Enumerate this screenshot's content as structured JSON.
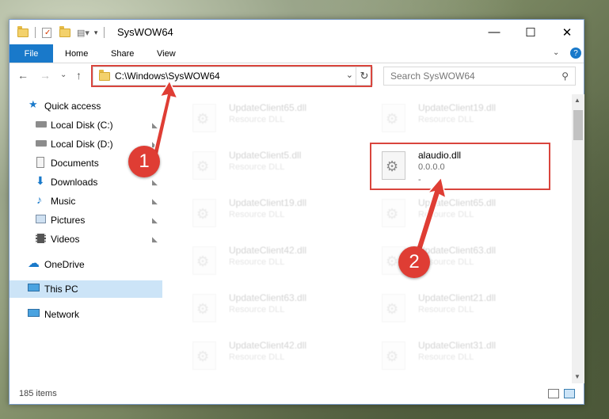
{
  "window": {
    "title": "SysWOW64",
    "buttons": {
      "minimize": "—",
      "maximize": "☐",
      "close": "✕"
    }
  },
  "ribbon": {
    "tabs": [
      "File",
      "Home",
      "Share",
      "View"
    ],
    "help": "?"
  },
  "navigation": {
    "back": "←",
    "forward": "→",
    "dropdown": "⌄",
    "up": "↑",
    "address": "C:\\Windows\\SysWOW64",
    "address_dropdown": "⌄",
    "refresh": "↻",
    "search_placeholder": "Search SysWOW64",
    "search_icon": "⚲"
  },
  "sidebar": {
    "items": [
      {
        "label": "Quick access",
        "icon": "star-icon",
        "pinned": false,
        "selected": false
      },
      {
        "label": "Local Disk (C:)",
        "icon": "drive-icon",
        "pinned": true,
        "selected": false
      },
      {
        "label": "Local Disk (D:)",
        "icon": "drive-icon",
        "pinned": true,
        "selected": false
      },
      {
        "label": "Documents",
        "icon": "documents-icon",
        "pinned": true,
        "selected": false
      },
      {
        "label": "Downloads",
        "icon": "download-icon",
        "pinned": true,
        "selected": false
      },
      {
        "label": "Music",
        "icon": "music-icon",
        "pinned": true,
        "selected": false
      },
      {
        "label": "Pictures",
        "icon": "pictures-icon",
        "pinned": true,
        "selected": false
      },
      {
        "label": "Videos",
        "icon": "videos-icon",
        "pinned": true,
        "selected": false
      },
      {
        "label": "OneDrive",
        "icon": "cloud-icon",
        "pinned": false,
        "selected": false
      },
      {
        "label": "This PC",
        "icon": "computer-icon",
        "pinned": false,
        "selected": true
      },
      {
        "label": "Network",
        "icon": "network-icon",
        "pinned": false,
        "selected": false
      }
    ],
    "pin_glyph": "📌"
  },
  "files": {
    "left": [
      {
        "name": "UpdateClient65.dll",
        "type": "Resource DLL"
      },
      {
        "name": "UpdateClient5.dll",
        "type": "Resource DLL"
      },
      {
        "name": "UpdateClient19.dll",
        "type": "Resource DLL"
      },
      {
        "name": "UpdateClient42.dll",
        "type": "Resource DLL"
      },
      {
        "name": "UpdateClient63.dll",
        "type": "Resource DLL"
      },
      {
        "name": "UpdateClient42.dll",
        "type": "Resource DLL"
      }
    ],
    "right": [
      {
        "name": "UpdateClient19.dll",
        "type": "Resource DLL"
      },
      {
        "name": "UpdateClient65.dll",
        "type": "Resource DLL"
      },
      {
        "name": "UpdateClient63.dll",
        "type": "Resource DLL"
      },
      {
        "name": "UpdateClient21.dll",
        "type": "Resource DLL"
      },
      {
        "name": "UpdateClient31.dll",
        "type": "Resource DLL"
      }
    ],
    "highlighted": {
      "name": "alaudio.dll",
      "version": "0.0.0.0",
      "extra": "-"
    }
  },
  "status": {
    "items": "185 items"
  },
  "annotations": {
    "markers": [
      "1",
      "2"
    ],
    "color": "#df3d34"
  },
  "colors": {
    "accent": "#1979ca",
    "selection": "#cce4f7",
    "annotation": "#d9453d"
  }
}
